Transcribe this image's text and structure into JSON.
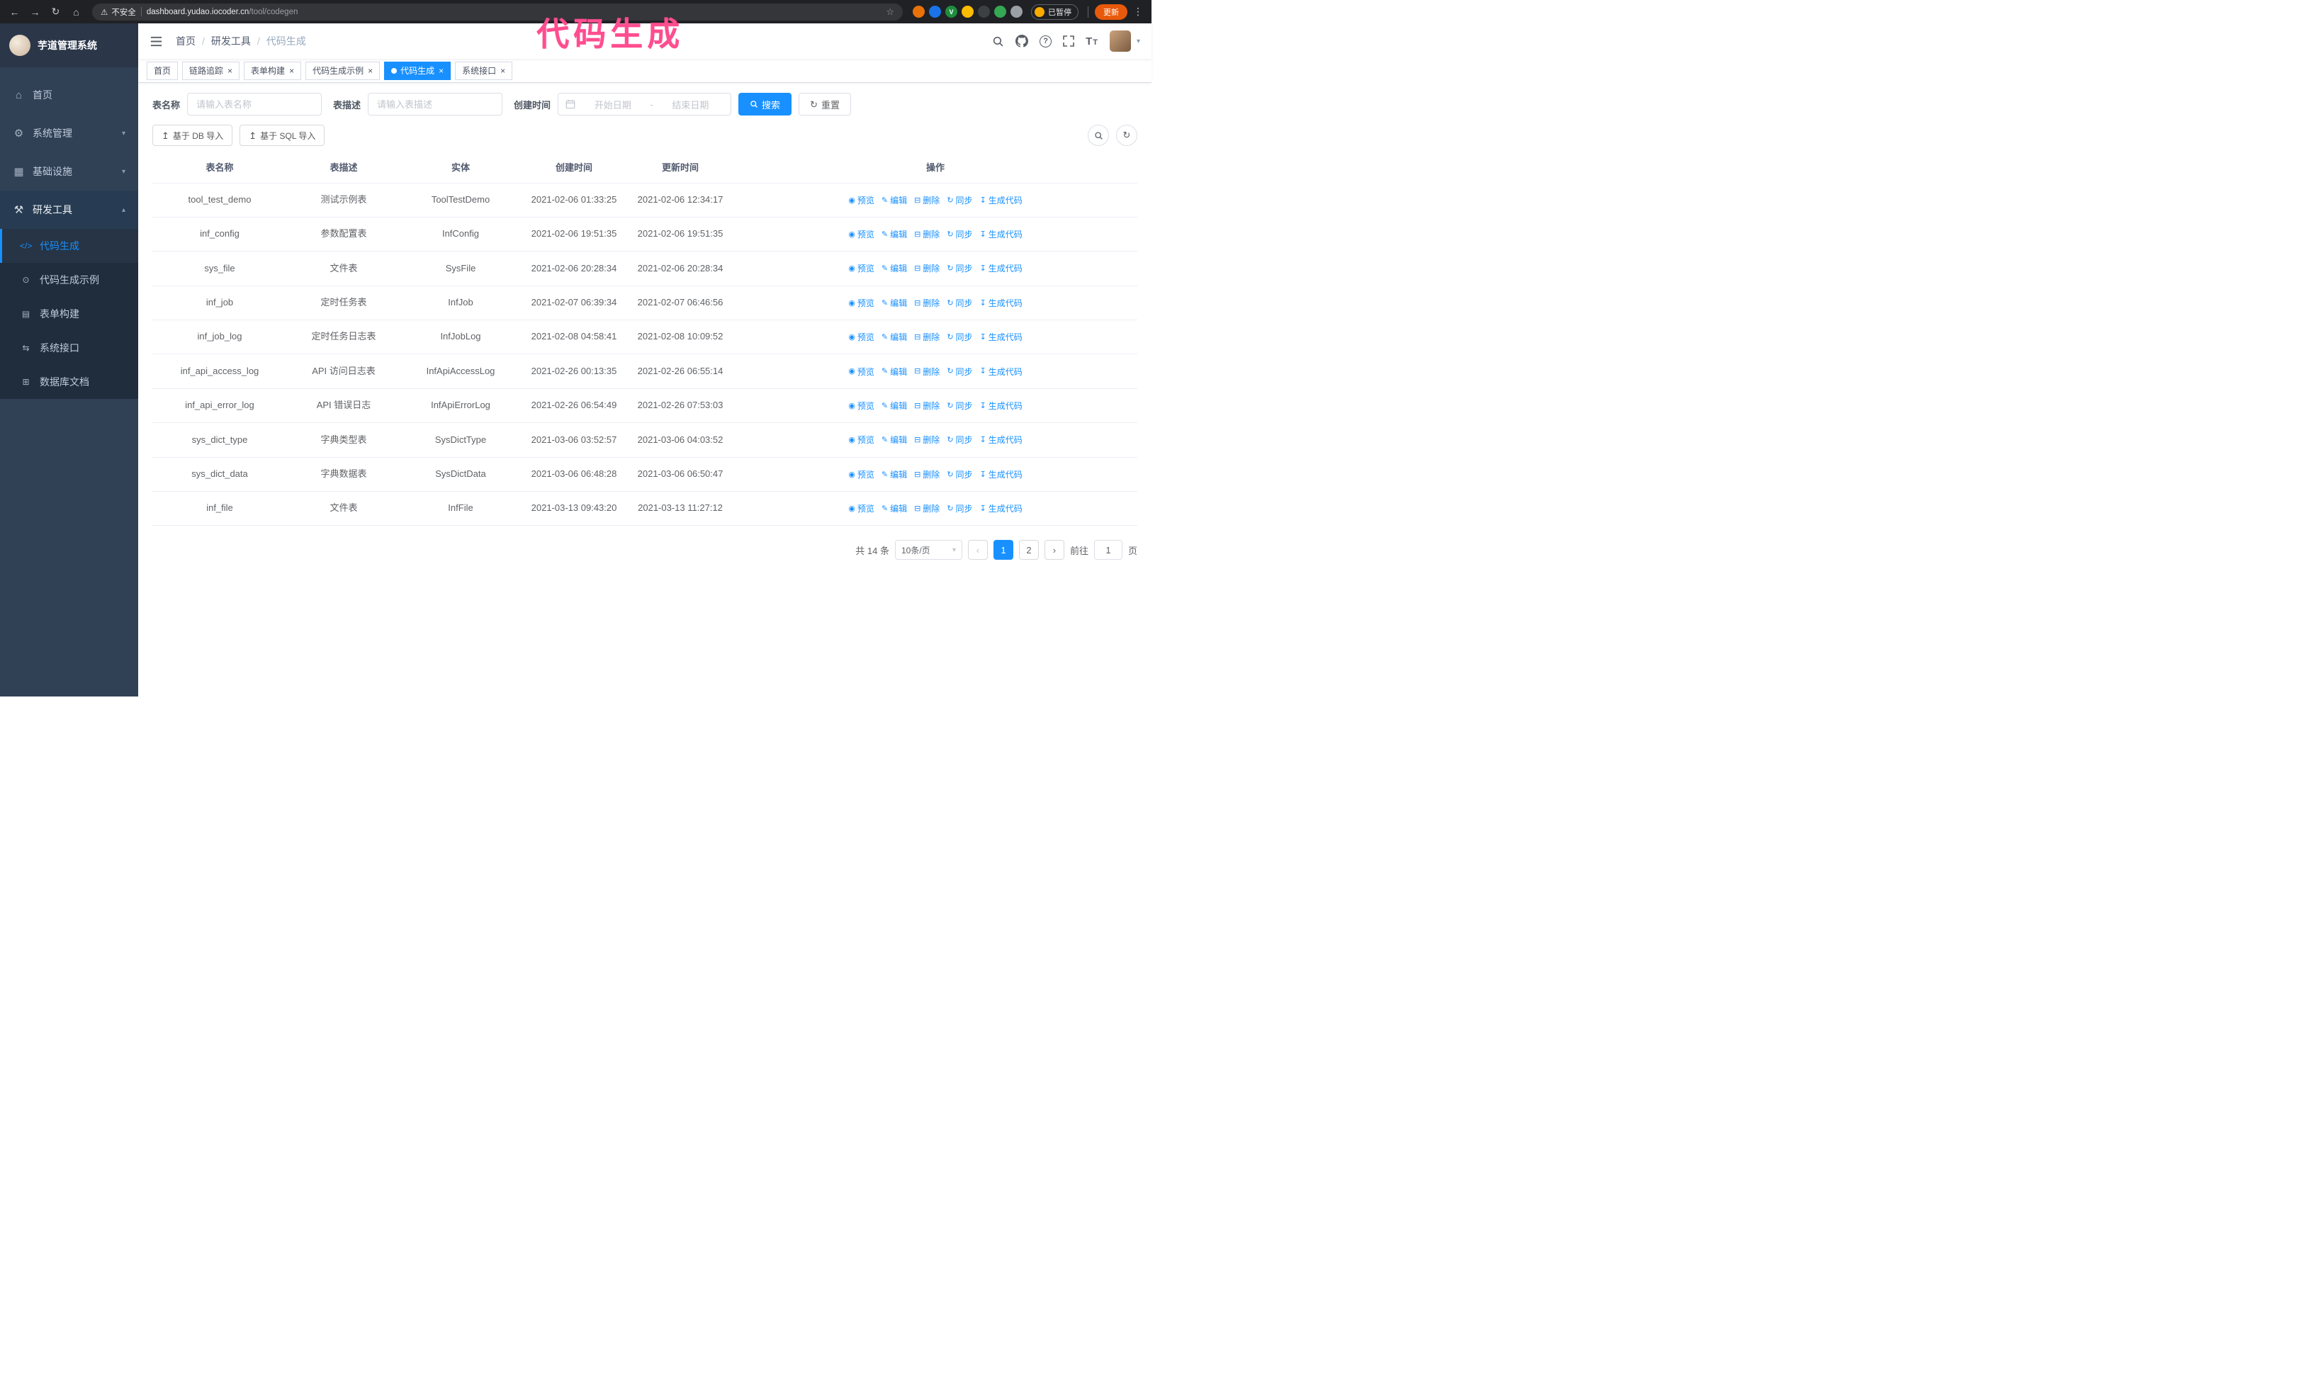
{
  "colors": {
    "accent": "#1890ff",
    "annotation": "#ff4d8f",
    "sidebar_bg": "#304156",
    "update_button": "#e8590c"
  },
  "icons": {
    "back": "←",
    "forward": "→",
    "reload": "↻",
    "home": "⌂",
    "warning": "⚠",
    "star": "☆",
    "menu": "⋮",
    "caret_down": "▾",
    "reset": "↻",
    "upload": "↥"
  },
  "annotation": {
    "text": "代码生成"
  },
  "browser": {
    "security_label": "不安全",
    "url_host": "dashboard.yudao.iocoder.cn",
    "url_path": "/tool/codegen",
    "paused_badge": "已暂停",
    "update_button": "更新",
    "extensions": [
      {
        "id": "extension-orange",
        "color": "#e8710a",
        "letter": ""
      },
      {
        "id": "extension-blue",
        "color": "#1a73e8",
        "letter": ""
      },
      {
        "id": "extension-green-v",
        "color": "#1e8e3e",
        "letter": "V"
      },
      {
        "id": "extension-grid",
        "color": "#fbbc04",
        "letter": ""
      },
      {
        "id": "extension-dark",
        "color": "#3c4043",
        "letter": ""
      },
      {
        "id": "extension-leaf",
        "color": "#34a853",
        "letter": ""
      },
      {
        "id": "extension-puzzle",
        "color": "#9aa0a6",
        "letter": ""
      }
    ]
  },
  "sidebar": {
    "logo_title": "芋道管理系统",
    "menu": [
      {
        "id": "home",
        "label": "首页",
        "icon": "⌂"
      },
      {
        "id": "system-manage",
        "label": "系统管理",
        "icon": "⚙",
        "arrow": "▾"
      },
      {
        "id": "infrastructure",
        "label": "基础设施",
        "icon": "▦",
        "arrow": "▾"
      },
      {
        "id": "dev-tools",
        "label": "研发工具",
        "icon": "⚒",
        "arrow": "▴",
        "expanded": true,
        "children": [
          {
            "id": "codegen",
            "label": "代码生成",
            "icon": "</>",
            "active": true
          },
          {
            "id": "codegen-example",
            "label": "代码生成示例",
            "icon": "⊙"
          },
          {
            "id": "form-builder",
            "label": "表单构建",
            "icon": "▤"
          },
          {
            "id": "system-api",
            "label": "系统接口",
            "icon": "⇆"
          },
          {
            "id": "db-doc",
            "label": "数据库文档",
            "icon": "⊞"
          }
        ]
      }
    ]
  },
  "header": {
    "breadcrumb": [
      "首页",
      "研发工具",
      "代码生成"
    ]
  },
  "tabs": [
    {
      "id": "home",
      "label": "首页",
      "closable": false
    },
    {
      "id": "tracer",
      "label": "链路追踪",
      "closable": true
    },
    {
      "id": "form-builder",
      "label": "表单构建",
      "closable": true
    },
    {
      "id": "codegen-example",
      "label": "代码生成示例",
      "closable": true
    },
    {
      "id": "codegen",
      "label": "代码生成",
      "closable": true,
      "active": true
    },
    {
      "id": "system-api",
      "label": "系统接口",
      "closable": true
    }
  ],
  "filters": {
    "table_name_label": "表名称",
    "table_name_placeholder": "请输入表名称",
    "table_desc_label": "表描述",
    "table_desc_placeholder": "请输入表描述",
    "create_time_label": "创建时间",
    "date_start_placeholder": "开始日期",
    "date_separator": "-",
    "date_end_placeholder": "结束日期",
    "search_button": "搜索",
    "reset_button": "重置"
  },
  "toolbar": {
    "import_db": "基于 DB 导入",
    "import_sql": "基于 SQL 导入"
  },
  "table": {
    "columns": [
      "表名称",
      "表描述",
      "实体",
      "创建时间",
      "更新时间",
      "操作"
    ],
    "actions": [
      {
        "id": "preview",
        "label": "预览",
        "icon": "◉"
      },
      {
        "id": "edit",
        "label": "编辑",
        "icon": "✎"
      },
      {
        "id": "delete",
        "label": "删除",
        "icon": "⊟"
      },
      {
        "id": "sync",
        "label": "同步",
        "icon": "↻"
      },
      {
        "id": "generate",
        "label": "生成代码",
        "icon": "↧"
      }
    ],
    "rows": [
      {
        "name": "tool_test_demo",
        "desc": "测试示例表",
        "entity": "ToolTestDemo",
        "created": "2021-02-06 01:33:25",
        "updated": "2021-02-06 12:34:17"
      },
      {
        "name": "inf_config",
        "desc": "参数配置表",
        "entity": "InfConfig",
        "created": "2021-02-06 19:51:35",
        "updated": "2021-02-06 19:51:35"
      },
      {
        "name": "sys_file",
        "desc": "文件表",
        "entity": "SysFile",
        "created": "2021-02-06 20:28:34",
        "updated": "2021-02-06 20:28:34"
      },
      {
        "name": "inf_job",
        "desc": "定时任务表",
        "entity": "InfJob",
        "created": "2021-02-07 06:39:34",
        "updated": "2021-02-07 06:46:56"
      },
      {
        "name": "inf_job_log",
        "desc": "定时任务日志表",
        "entity": "InfJobLog",
        "created": "2021-02-08 04:58:41",
        "updated": "2021-02-08 10:09:52"
      },
      {
        "name": "inf_api_access_log",
        "desc": "API 访问日志表",
        "entity": "InfApiAccessLog",
        "created": "2021-02-26 00:13:35",
        "updated": "2021-02-26 06:55:14"
      },
      {
        "name": "inf_api_error_log",
        "desc": "API 错误日志",
        "entity": "InfApiErrorLog",
        "created": "2021-02-26 06:54:49",
        "updated": "2021-02-26 07:53:03"
      },
      {
        "name": "sys_dict_type",
        "desc": "字典类型表",
        "entity": "SysDictType",
        "created": "2021-03-06 03:52:57",
        "updated": "2021-03-06 04:03:52"
      },
      {
        "name": "sys_dict_data",
        "desc": "字典数据表",
        "entity": "SysDictData",
        "created": "2021-03-06 06:48:28",
        "updated": "2021-03-06 06:50:47"
      },
      {
        "name": "inf_file",
        "desc": "文件表",
        "entity": "InfFile",
        "created": "2021-03-13 09:43:20",
        "updated": "2021-03-13 11:27:12"
      }
    ]
  },
  "pagination": {
    "total": "共 14 条",
    "page_size": "10条/页",
    "prev": "‹",
    "next": "›",
    "pages": [
      "1",
      "2"
    ],
    "active_page": "1",
    "goto_label": "前往",
    "goto_value": "1",
    "goto_unit": "页"
  }
}
